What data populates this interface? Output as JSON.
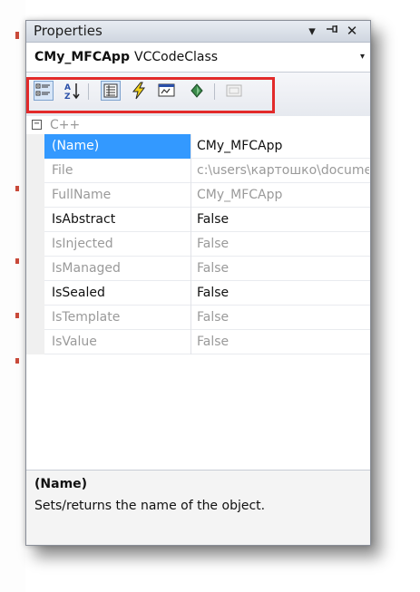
{
  "window": {
    "title": "Properties",
    "controls": {
      "pin_menu": "▾",
      "auto_hide": "⊣",
      "close": "✕"
    }
  },
  "selector": {
    "object_name": "CMy_MFCApp",
    "object_type": "VCCodeClass",
    "dropdown_arrow": "▾"
  },
  "toolbar": {
    "buttons": [
      {
        "icon": "categorized-icon",
        "pressed": true
      },
      {
        "icon": "alphabetical-icon",
        "pressed": false
      },
      {
        "icon": "properties-icon",
        "pressed": true
      },
      {
        "icon": "events-icon",
        "pressed": false
      },
      {
        "icon": "messages-icon",
        "pressed": false
      },
      {
        "icon": "overrides-icon",
        "pressed": false
      },
      {
        "icon": "property-pages-icon",
        "pressed": false,
        "disabled": true
      }
    ],
    "highlight_color": "#e22a2a"
  },
  "grid": {
    "category": {
      "expander": "−",
      "label": "C++"
    },
    "rows": [
      {
        "name": "(Name)",
        "value": "CMy_MFCApp",
        "selected": true,
        "readonly": false
      },
      {
        "name": "File",
        "value": "c:\\users\\картошко\\documents",
        "selected": false,
        "readonly": true
      },
      {
        "name": "FullName",
        "value": "CMy_MFCApp",
        "selected": false,
        "readonly": true
      },
      {
        "name": "IsAbstract",
        "value": "False",
        "selected": false,
        "readonly": false
      },
      {
        "name": "IsInjected",
        "value": "False",
        "selected": false,
        "readonly": true
      },
      {
        "name": "IsManaged",
        "value": "False",
        "selected": false,
        "readonly": true
      },
      {
        "name": "IsSealed",
        "value": "False",
        "selected": false,
        "readonly": false
      },
      {
        "name": "IsTemplate",
        "value": "False",
        "selected": false,
        "readonly": true
      },
      {
        "name": "IsValue",
        "value": "False",
        "selected": false,
        "readonly": true
      }
    ]
  },
  "description": {
    "title": "(Name)",
    "text": "Sets/returns the name of the object."
  },
  "colors": {
    "selection": "#3399ff",
    "readonly_text": "#9a9a9a",
    "titlebar": "#dfe4ec"
  }
}
